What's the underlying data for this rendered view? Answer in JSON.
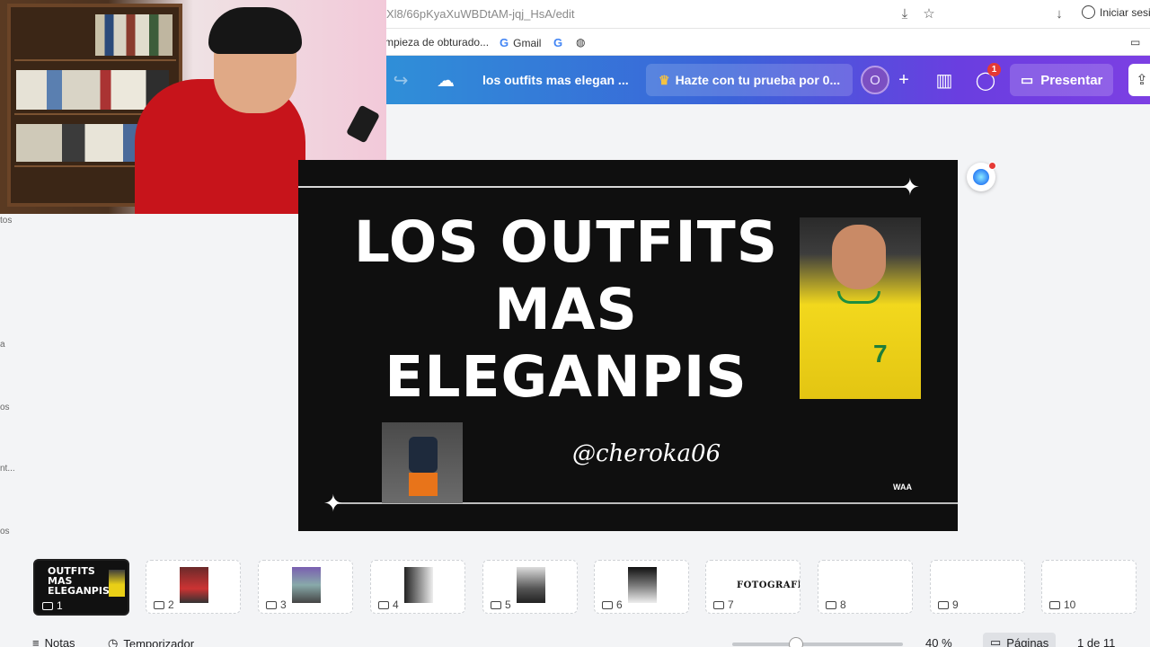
{
  "browser": {
    "url": "Xl8/66pKyaXuWBDtAM-jqj_HsA/edit",
    "signin_label": "Iniciar sesi",
    "bookmarks": [
      "mpieza de obturado...",
      "Gmail"
    ],
    "g_letter": "G"
  },
  "toolbar": {
    "doc_title": "los outfits mas elegan ...",
    "trial_label": "Hazte con tu prueba por 0...",
    "avatar_initial": "O",
    "notif_count": "1",
    "present_label": "Presentar"
  },
  "left_strip": {
    "labels": [
      "tos",
      "a",
      "os",
      "nt...",
      "os"
    ]
  },
  "slide": {
    "title_line1": "LOS OUTFITS",
    "title_line2": "MAS",
    "title_line3": "ELEGANPIS",
    "handle": "@cheroka06",
    "corner_tag": "WAA",
    "photo_number": "7"
  },
  "thumbnails": {
    "first_title": "OUTFITS MAS ELEGANPIS",
    "pages": [
      "1",
      "2",
      "3",
      "4",
      "5",
      "6",
      "7",
      "8",
      "9",
      "10"
    ],
    "page7_text": "FOTOGRAFÍA"
  },
  "statusbar": {
    "notes_label": "Notas",
    "timer_label": "Temporizador",
    "zoom": "40 %",
    "pages_label": "Páginas",
    "page_count": "1 de 11"
  },
  "colors": {
    "toolbar_start": "#2f8fd8",
    "toolbar_end": "#7c3fe3",
    "slide_bg": "#0f0f0f",
    "badge": "#e53935"
  },
  "icons": [
    "download-icon",
    "star-icon",
    "account-icon",
    "redo-icon",
    "cloud-sync-icon",
    "crown-icon",
    "plus-icon",
    "chart-icon",
    "comment-icon",
    "present-icon",
    "share-icon",
    "magic-icon",
    "sparkle-icon",
    "notes-icon",
    "timer-icon",
    "grid-icon",
    "folder-icon"
  ]
}
